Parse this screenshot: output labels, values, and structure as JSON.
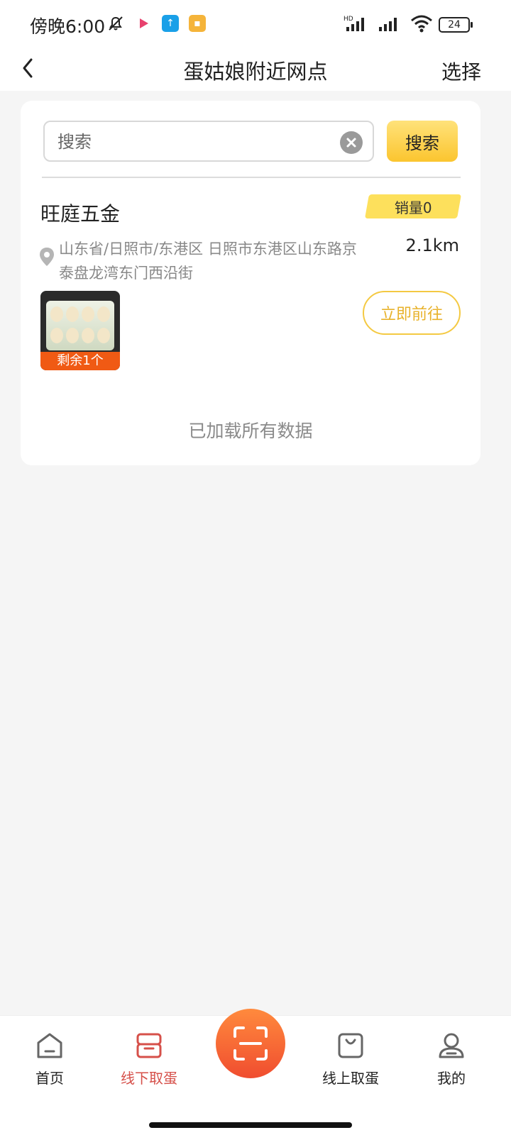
{
  "status_bar": {
    "time": "傍晚6:00",
    "battery": "24"
  },
  "header": {
    "title": "蛋姑娘附近网点",
    "select_label": "选择"
  },
  "search": {
    "placeholder": "搜索",
    "button_label": "搜索"
  },
  "store": {
    "name": "旺庭五金",
    "sales": "销量0",
    "address": "山东省/日照市/东港区 日照市东港区山东路京泰盘龙湾东门西沿街",
    "distance": "2.1km",
    "remaining": "剩余1个",
    "go_label": "立即前往"
  },
  "list_status": "已加载所有数据",
  "bottom_nav": {
    "home": "首页",
    "offline": "线下取蛋",
    "online": "线上取蛋",
    "me": "我的"
  },
  "colors": {
    "accent_yellow": "#fbc52f",
    "active_red": "#d6504a",
    "badge_orange": "#f05a14",
    "scan_orange": "#ff8a3d"
  }
}
